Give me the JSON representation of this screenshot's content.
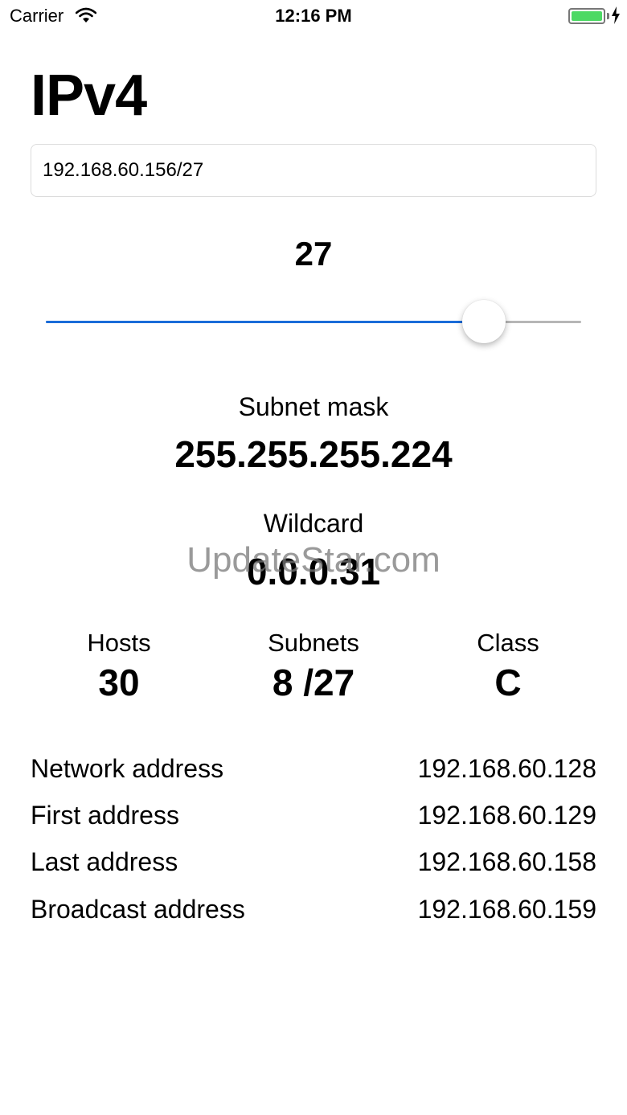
{
  "status_bar": {
    "carrier": "Carrier",
    "time": "12:16 PM",
    "battery_color": "#4cd964"
  },
  "title": "IPv4",
  "ip_input": {
    "value": "192.168.60.156/27"
  },
  "prefix": {
    "value": "27",
    "slider_fraction": 0.819,
    "accent": "#1a6cd9"
  },
  "subnet_mask": {
    "label": "Subnet mask",
    "value": "255.255.255.224"
  },
  "wildcard": {
    "label": "Wildcard",
    "value": "0.0.0.31"
  },
  "watermark": "UpdateStar.com",
  "stats": [
    {
      "label": "Hosts",
      "value": "30"
    },
    {
      "label": "Subnets",
      "value": "8 /27"
    },
    {
      "label": "Class",
      "value": "C"
    }
  ],
  "addresses": [
    {
      "label": "Network address",
      "value": "192.168.60.128"
    },
    {
      "label": "First address",
      "value": "192.168.60.129"
    },
    {
      "label": "Last address",
      "value": "192.168.60.158"
    },
    {
      "label": "Broadcast address",
      "value": "192.168.60.159"
    }
  ],
  "icons": {
    "wifi": "wifi-icon",
    "battery": "battery-icon",
    "charging": "charging-icon"
  }
}
